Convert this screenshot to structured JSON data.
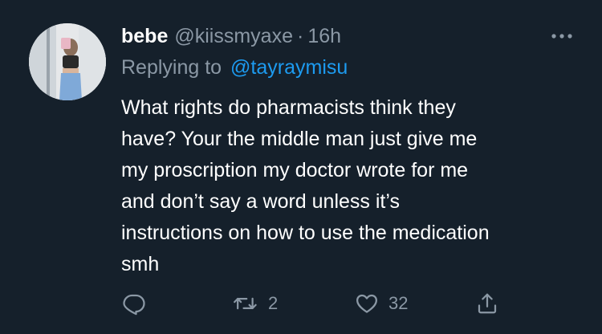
{
  "tweet": {
    "display_name": "bebe",
    "handle": "@kiissmyaxe",
    "separator": "·",
    "time": "16h",
    "replying_label": "Replying to",
    "replying_to": "@tayraymisu",
    "body_lines": [
      "What rights do pharmacists think they",
      "have? Your the middle man just give me",
      "my proscription my doctor wrote for me",
      "and don’t say a word unless it’s",
      "instructions on how to use the medication",
      "smh"
    ],
    "actions": {
      "retweet_count": "2",
      "like_count": "32"
    }
  },
  "icons": {
    "more": "more-horizontal-icon",
    "reply": "reply-icon",
    "retweet": "retweet-icon",
    "like": "heart-icon",
    "share": "share-icon"
  },
  "colors": {
    "background": "#15202b",
    "secondary_text": "#8b98a5",
    "link": "#1d9bf0",
    "primary_text": "#ffffff"
  }
}
